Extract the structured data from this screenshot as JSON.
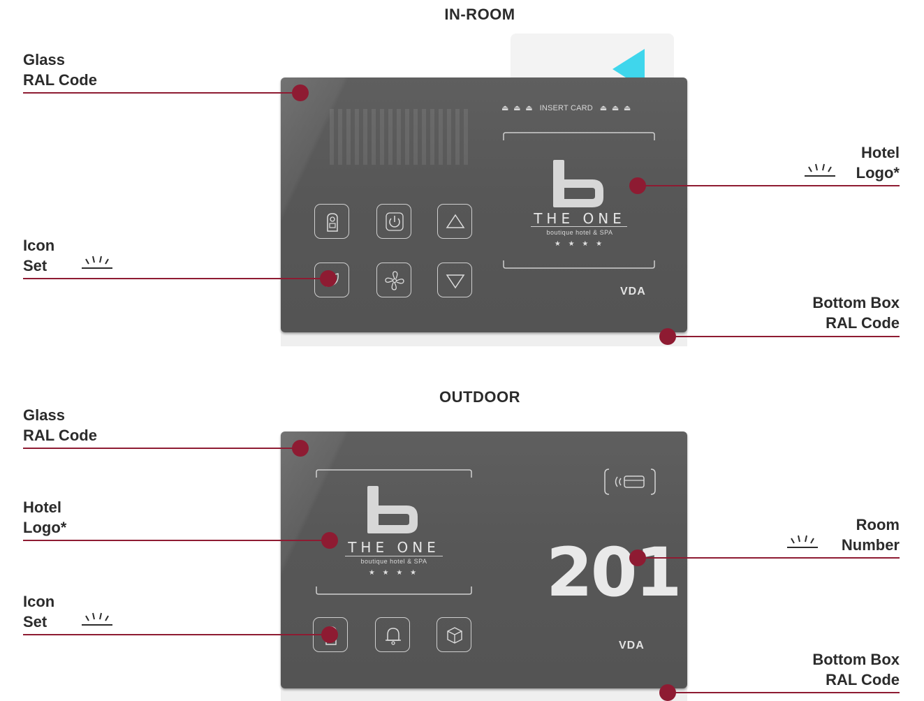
{
  "titles": {
    "in_room": "IN-ROOM",
    "outdoor": "OUTDOOR"
  },
  "in_room": {
    "labels": {
      "glass": [
        "Glass",
        "RAL Code"
      ],
      "icon_set": [
        "Icon",
        "Set"
      ],
      "hotel_logo": [
        "Hotel",
        "Logo*"
      ],
      "bottom_box": [
        "Bottom Box",
        "RAL Code"
      ]
    },
    "panel": {
      "insert_card": "INSERT CARD",
      "logo_name": "THE ONE",
      "logo_sub": "boutique hotel & SPA",
      "logo_stars": "★ ★ ★ ★",
      "brand": "VDA",
      "buttons": [
        "do-not-disturb-icon",
        "power-icon",
        "arrow-up-icon",
        "leaf-icon",
        "fan-icon",
        "arrow-down-icon"
      ]
    }
  },
  "outdoor": {
    "labels": {
      "glass": [
        "Glass",
        "RAL Code"
      ],
      "hotel_logo": [
        "Hotel",
        "Logo*"
      ],
      "icon_set": [
        "Icon",
        "Set"
      ],
      "room_number": [
        "Room",
        "Number"
      ],
      "bottom_box": [
        "Bottom Box",
        "RAL Code"
      ]
    },
    "panel": {
      "logo_name": "THE ONE",
      "logo_sub": "boutique hotel & SPA",
      "logo_stars": "★ ★ ★ ★",
      "room_number": "201",
      "brand": "VDA",
      "buttons": [
        "do-not-disturb-icon",
        "bell-icon",
        "cube-icon"
      ],
      "nfc_icon": "nfc-card-icon"
    }
  },
  "colors": {
    "accent": "#8e1b32",
    "glass": "#575757",
    "card_arrow": "#3fd6ec"
  }
}
